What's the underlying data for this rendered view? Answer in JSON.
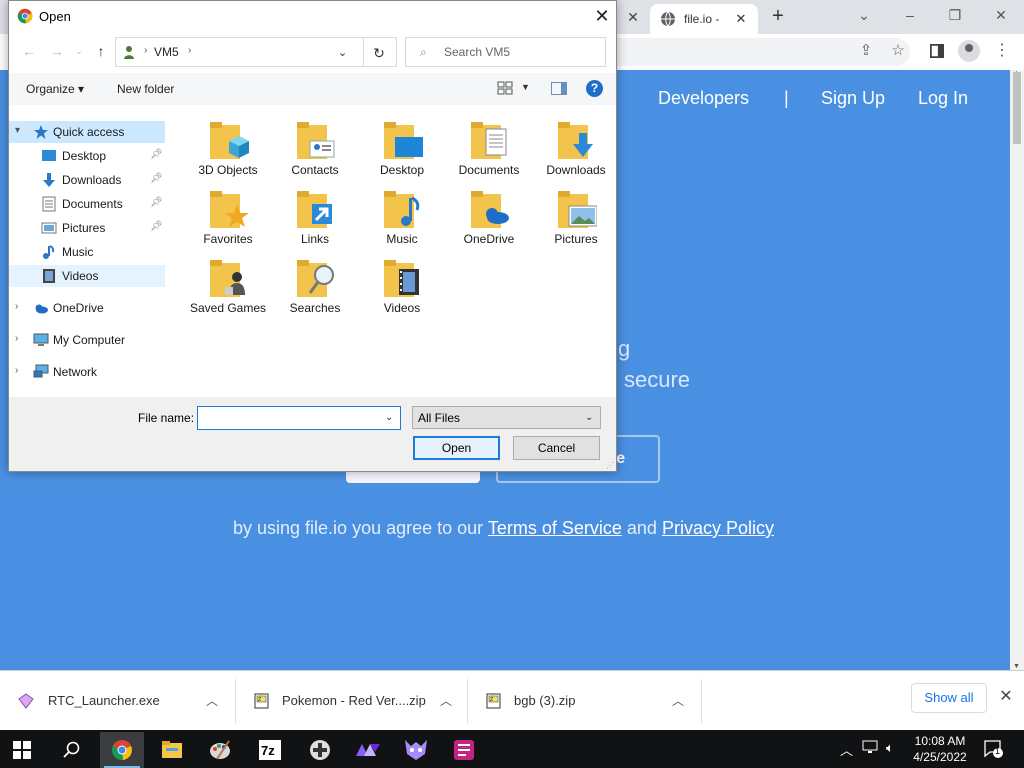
{
  "browser": {
    "tab_title": "file.io -",
    "new_tab": "+"
  },
  "page": {
    "nav": [
      "Developers",
      "|",
      "Sign Up",
      "Log In"
    ],
    "hero_line1_fragment": "g",
    "hero_line2_fragment": "secure",
    "cta_fragment": "re",
    "terms_prefix": "by using file.io you agree to our",
    "terms_link": "Terms of Service",
    "terms_and": "and",
    "privacy_link": "Privacy Policy"
  },
  "dialog": {
    "title": "Open",
    "breadcrumb": [
      "VM5"
    ],
    "search_placeholder": "Search VM5",
    "commands": {
      "organize": "Organize ▾",
      "new_folder": "New folder"
    },
    "nav_pane": [
      {
        "label": "Quick access",
        "icon": "star-icon"
      },
      {
        "label": "Desktop",
        "icon": "desktop-icon"
      },
      {
        "label": "Downloads",
        "icon": "downloads-icon"
      },
      {
        "label": "Documents",
        "icon": "documents-icon"
      },
      {
        "label": "Pictures",
        "icon": "pictures-icon"
      },
      {
        "label": "Music",
        "icon": "music-icon"
      },
      {
        "label": "Videos",
        "icon": "videos-icon"
      },
      {
        "label": "OneDrive",
        "icon": "onedrive-icon"
      },
      {
        "label": "My Computer",
        "icon": "computer-icon"
      },
      {
        "label": "Network",
        "icon": "network-icon"
      }
    ],
    "files": [
      {
        "name": "3D Objects",
        "icon": "3d-objects-folder-icon"
      },
      {
        "name": "Contacts",
        "icon": "contacts-folder-icon"
      },
      {
        "name": "Desktop",
        "icon": "desktop-folder-icon"
      },
      {
        "name": "Documents",
        "icon": "documents-folder-icon"
      },
      {
        "name": "Downloads",
        "icon": "downloads-folder-icon"
      },
      {
        "name": "Favorites",
        "icon": "favorites-folder-icon"
      },
      {
        "name": "Links",
        "icon": "links-folder-icon"
      },
      {
        "name": "Music",
        "icon": "music-folder-icon"
      },
      {
        "name": "OneDrive",
        "icon": "onedrive-folder-icon"
      },
      {
        "name": "Pictures",
        "icon": "pictures-folder-icon"
      },
      {
        "name": "Saved Games",
        "icon": "saved-games-folder-icon"
      },
      {
        "name": "Searches",
        "icon": "searches-folder-icon"
      },
      {
        "name": "Videos",
        "icon": "videos-folder-icon"
      }
    ],
    "file_name_label": "File name:",
    "file_name_value": "",
    "file_type": "All Files",
    "open_button": "Open",
    "cancel_button": "Cancel"
  },
  "downloads": [
    {
      "name": "RTC_Launcher.exe"
    },
    {
      "name": "Pokemon - Red Ver....zip"
    },
    {
      "name": "bgb (3).zip"
    }
  ],
  "show_all": "Show all",
  "taskbar": {
    "time": "10:08 AM",
    "date": "4/25/2022",
    "notification_count": "1"
  },
  "colors": {
    "page_bg": "#4a90e2",
    "selection": "#cce8ff",
    "accent": "#1e7bd4"
  }
}
